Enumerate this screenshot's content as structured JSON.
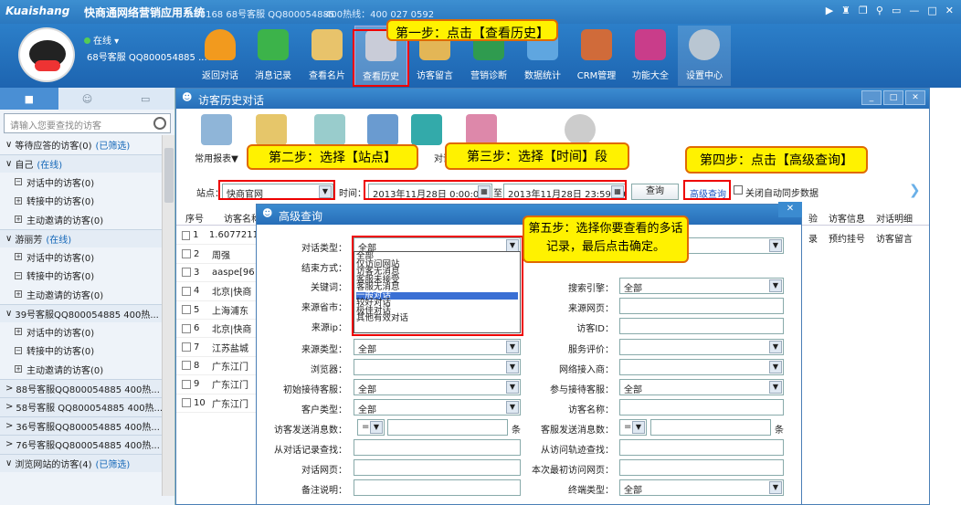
{
  "titlebar": {
    "logo": "Kuaishang",
    "app_name": "快商通网络营销应用系统",
    "info": "168168 68号客服 QQ800054885",
    "hotline": "400热线：400 027 0592"
  },
  "toolbar": {
    "status": "在线",
    "agent": "68号客服 QQ800054885 ...",
    "items": [
      "返回对话",
      "消息记录",
      "查看名片",
      "查看历史",
      "访客留言",
      "营销诊断",
      "数据统计",
      "CRM管理",
      "功能大全",
      "设置中心"
    ]
  },
  "leftpane": {
    "search_placeholder": "请输入您要查找的访客",
    "rows": [
      {
        "text": "等待应答的访客(0)",
        "tag": "(已筛选)"
      },
      {
        "text": "自己",
        "tag": "(在线)"
      },
      {
        "text": "对话中的访客(0)"
      },
      {
        "text": "转接中的访客(0)"
      },
      {
        "text": "主动邀请的访客(0)"
      },
      {
        "text": "游丽芳",
        "tag": "(在线)"
      },
      {
        "text": "对话中的访客(0)"
      },
      {
        "text": "转接中的访客(0)"
      },
      {
        "text": "主动邀请的访客(0)"
      },
      {
        "text": "39号客服QQ800054885  400热..."
      },
      {
        "text": "对话中的访客(0)"
      },
      {
        "text": "转接中的访客(0)"
      },
      {
        "text": "主动邀请的访客(0)"
      },
      {
        "text": "88号客服QQ800054885  400热..."
      },
      {
        "text": "58号客服 QQ800054885  400热..."
      },
      {
        "text": "36号客服QQ800054885  400热..."
      },
      {
        "text": "76号客服QQ800054885  400热..."
      },
      {
        "text": "浏览网站的访客(4)",
        "tag": "(已筛选)"
      }
    ]
  },
  "history": {
    "title": "访客历史对话",
    "tool_report": "常用报表▼",
    "tool_dialog": "对话",
    "site_label": "站点：",
    "site_value": "快商官网",
    "time_label": "时间：",
    "time_from": "2013年11月28日  0:00:00",
    "time_to_label": "至",
    "time_to": "2013年11月28日  23:59:59",
    "query_btn": "查询",
    "adv_btn": "高级查询",
    "sync_label": "关闭自动同步数据",
    "col_no": "序号",
    "col_visitor": "访客名称",
    "col_info": "访客信息",
    "col_detail": "对话明细",
    "col_reg": "预约挂号",
    "col_msg": "访客留言",
    "rows": [
      {
        "no": "1",
        "name": "1.6077211"
      },
      {
        "no": "2",
        "name": "周强"
      },
      {
        "no": "3",
        "name": "aaspe[96"
      },
      {
        "no": "4",
        "name": "北京|快商"
      },
      {
        "no": "5",
        "name": "上海浦东"
      },
      {
        "no": "6",
        "name": "北京|快商"
      },
      {
        "no": "7",
        "name": "江苏盐城"
      },
      {
        "no": "8",
        "name": "广东江门"
      },
      {
        "no": "9",
        "name": "广东江门"
      },
      {
        "no": "10",
        "name": "广东江门"
      }
    ]
  },
  "advanced": {
    "title": "高级查询",
    "dialog_type_label": "对话类型：",
    "dialog_type_value": "全部",
    "end_label": "结束方式：",
    "keyword_label": "关键词：",
    "province_label": "来源省市：",
    "ip_label": "来源ip：",
    "src_type_label": "来源类型：",
    "src_type_value": "全部",
    "browser_label": "浏览器：",
    "first_agent_label": "初始接待客服：",
    "first_agent_value": "全部",
    "cust_type_label": "客户类型：",
    "cust_type_value": "全部",
    "visitor_msgs_label": "访客发送消息数：",
    "visitor_msgs_op": "=",
    "unit": "条",
    "from_record_label": "从对话记录查找：",
    "page_label": "对话网页：",
    "note_label": "备注说明：",
    "engine_label": "搜索引擎：",
    "engine_value": "全部",
    "src_page_label": "来源网页：",
    "visitor_id_label": "访客ID：",
    "rating_label": "服务评价：",
    "isp_label": "网络接入商：",
    "join_agent_label": "参与接待客服：",
    "join_agent_value": "全部",
    "visitor_name_label": "访客名称：",
    "agent_msgs_label": "客服发送消息数：",
    "agent_msgs_op": "=",
    "track_label": "从访问轨迹查找：",
    "last_page_label": "本次最初访问网页：",
    "device_label": "终端类型：",
    "device_value": "全部",
    "list_options": [
      "全部",
      "仅访问网站",
      "访客无消息",
      "客服未接受",
      "客服无消息",
      "一般对话",
      "较好对话",
      "极佳对话",
      "其他有效对话"
    ],
    "list_selected": "一般对话"
  },
  "callouts": {
    "step1": "第一步：点击【查看历史】",
    "step2": "第二步：选择【站点】",
    "step3": "第三步：选择【时间】段",
    "step4": "第四步：点击【高级查询】",
    "step5": "第五步：选择你要查看的多话记录，最后点击确定。"
  },
  "colors": {
    "titlebar": "#2b78bf",
    "callout": "#fff200",
    "callout_border": "#e06a00",
    "highlight": "#e00000"
  }
}
